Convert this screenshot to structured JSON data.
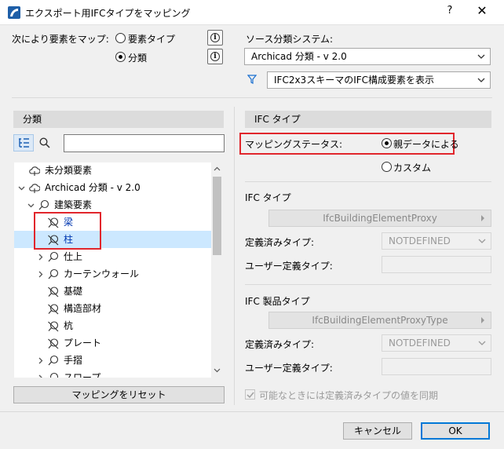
{
  "window": {
    "title": "エクスポート用IFCタイプをマッピング",
    "help_label": "?",
    "close_label": "✕"
  },
  "map_by": {
    "label": "次により要素をマップ:",
    "options": [
      {
        "label": "要素タイプ",
        "selected": false
      },
      {
        "label": "分類",
        "selected": true
      }
    ],
    "info_label": "i"
  },
  "source": {
    "label": "ソース分類システム:",
    "system_value": "Archicad 分類 - v 2.0",
    "filter_value": "IFC2x3スキーマのIFC構成要素を表示"
  },
  "left_panel": {
    "header": "分類",
    "search_placeholder": "",
    "tree": [
      {
        "label": "未分類要素",
        "level": 0,
        "expander": "",
        "icon": "cloud-icon",
        "highlight": false,
        "selected": false
      },
      {
        "label": "Archicad 分類 - v 2.0",
        "level": 0,
        "expander": "v",
        "icon": "cloud-icon",
        "highlight": false,
        "selected": false
      },
      {
        "label": "建築要素",
        "level": 1,
        "expander": "v",
        "icon": "tag-icon",
        "highlight": false,
        "selected": false
      },
      {
        "label": "梁",
        "level": 2,
        "expander": "",
        "icon": "excluded-tag-icon",
        "highlight": true,
        "selected": false
      },
      {
        "label": "柱",
        "level": 2,
        "expander": "",
        "icon": "excluded-tag-icon",
        "highlight": true,
        "selected": true
      },
      {
        "label": "仕上",
        "level": 2,
        "expander": ">",
        "icon": "tag-icon",
        "highlight": false,
        "selected": false
      },
      {
        "label": "カーテンウォール",
        "level": 2,
        "expander": ">",
        "icon": "tag-icon",
        "highlight": false,
        "selected": false
      },
      {
        "label": "基礎",
        "level": 2,
        "expander": "",
        "icon": "excluded-tag-icon",
        "highlight": false,
        "selected": false
      },
      {
        "label": "構造部材",
        "level": 2,
        "expander": "",
        "icon": "excluded-tag-icon",
        "highlight": false,
        "selected": false
      },
      {
        "label": "杭",
        "level": 2,
        "expander": "",
        "icon": "excluded-tag-icon",
        "highlight": false,
        "selected": false
      },
      {
        "label": "プレート",
        "level": 2,
        "expander": "",
        "icon": "excluded-tag-icon",
        "highlight": false,
        "selected": false
      },
      {
        "label": "手摺",
        "level": 2,
        "expander": ">",
        "icon": "tag-icon",
        "highlight": false,
        "selected": false
      },
      {
        "label": "スロープ",
        "level": 2,
        "expander": ">",
        "icon": "tag-icon",
        "highlight": false,
        "selected": false
      }
    ],
    "reset_label": "マッピングをリセット"
  },
  "right_panel": {
    "header": "IFC タイプ",
    "mapping_status": {
      "label": "マッピングステータス:",
      "options": [
        {
          "label": "親データによる",
          "selected": true
        },
        {
          "label": "カスタム",
          "selected": false
        }
      ]
    },
    "ifc_type": {
      "heading": "IFC タイプ",
      "value": "IfcBuildingElementProxy",
      "predefined_label": "定義済みタイプ:",
      "predefined_value": "NOTDEFINED",
      "user_defined_label": "ユーザー定義タイプ:",
      "user_defined_value": ""
    },
    "ifc_product_type": {
      "heading": "IFC 製品タイプ",
      "value": "IfcBuildingElementProxyType",
      "predefined_label": "定義済みタイプ:",
      "predefined_value": "NOTDEFINED",
      "user_defined_label": "ユーザー定義タイプ:",
      "user_defined_value": ""
    },
    "sync_label": "可能なときには定義済みタイプの値を同期",
    "sync_checked": true
  },
  "footer": {
    "cancel_label": "キャンセル",
    "ok_label": "OK"
  },
  "colors": {
    "highlight_box": "#e1262c",
    "selection": "#cce8ff",
    "link_text": "#0037b0",
    "default_button_border": "#0078d7"
  }
}
